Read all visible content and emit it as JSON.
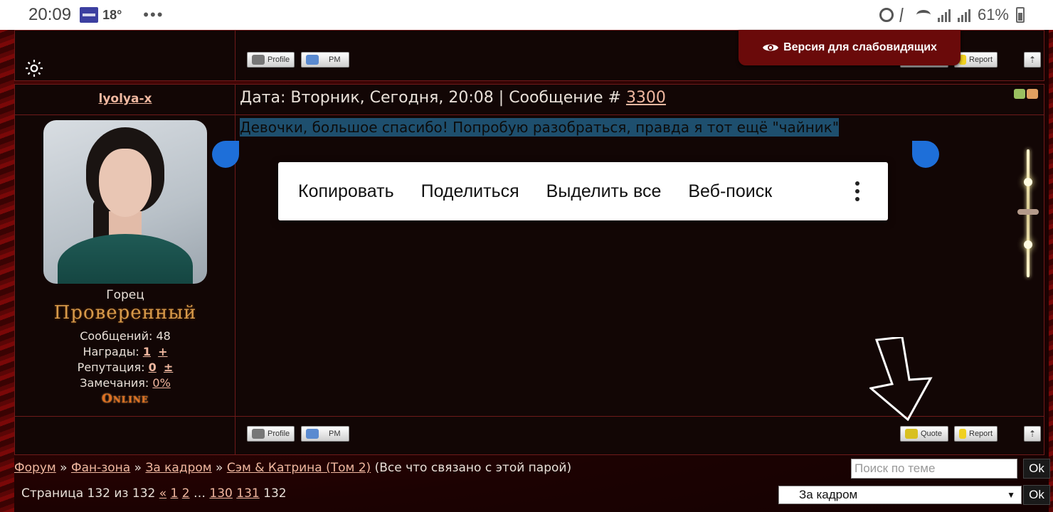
{
  "status_bar": {
    "time": "20:09",
    "temperature": "18°",
    "more": "•••",
    "battery": "61%"
  },
  "accessibility": {
    "label": "Версия для слабовидящих"
  },
  "buttons": {
    "profile": "Profile",
    "pm": "PM",
    "quote": "Quote",
    "report": "Report",
    "top": "⇡"
  },
  "post": {
    "author": "lyolya-x",
    "date_prefix": "Дата: Вторник, Сегодня, 20:08 | Сообщение # ",
    "message_number": "3300",
    "message": "Девочки, большое спасибо! Попробую разобраться, правда я тот ещё \"чайник\"",
    "rank": "Горец",
    "rank_title": "Проверенный",
    "posts_label": "Сообщений: 48",
    "awards_label": "Награды: ",
    "awards_value": "1",
    "awards_plus": "+",
    "reputation_label": "Репутация: ",
    "reputation_value": "0",
    "reputation_plusminus": "±",
    "warnings_label": "Замечания: ",
    "warnings_value": "0%",
    "online": "Online"
  },
  "context_menu": {
    "items": [
      "Копировать",
      "Поделиться",
      "Выделить все",
      "Веб-поиск"
    ]
  },
  "breadcrumb": {
    "items": [
      "Форум",
      "Фан-зона",
      "За кадром",
      "Сэм & Катрина (Том 2)"
    ],
    "separator": " » ",
    "suffix": " (Все что связано с этой парой)"
  },
  "pager": {
    "label": "Страница 132 из 132 ",
    "prev": "«",
    "p1": "1",
    "p2": "2",
    "ellipsis": " … ",
    "p130": "130",
    "p131": "131",
    "current": "132"
  },
  "search": {
    "placeholder": "Поиск по теме",
    "ok": "Ok"
  },
  "jump": {
    "selected": "За кадром",
    "ok": "Ok"
  },
  "colors": {
    "link": "#f0b8a0",
    "rank_title": "#d89a4a",
    "selection": "#1e4f6e",
    "handle": "#1e6fd9"
  }
}
